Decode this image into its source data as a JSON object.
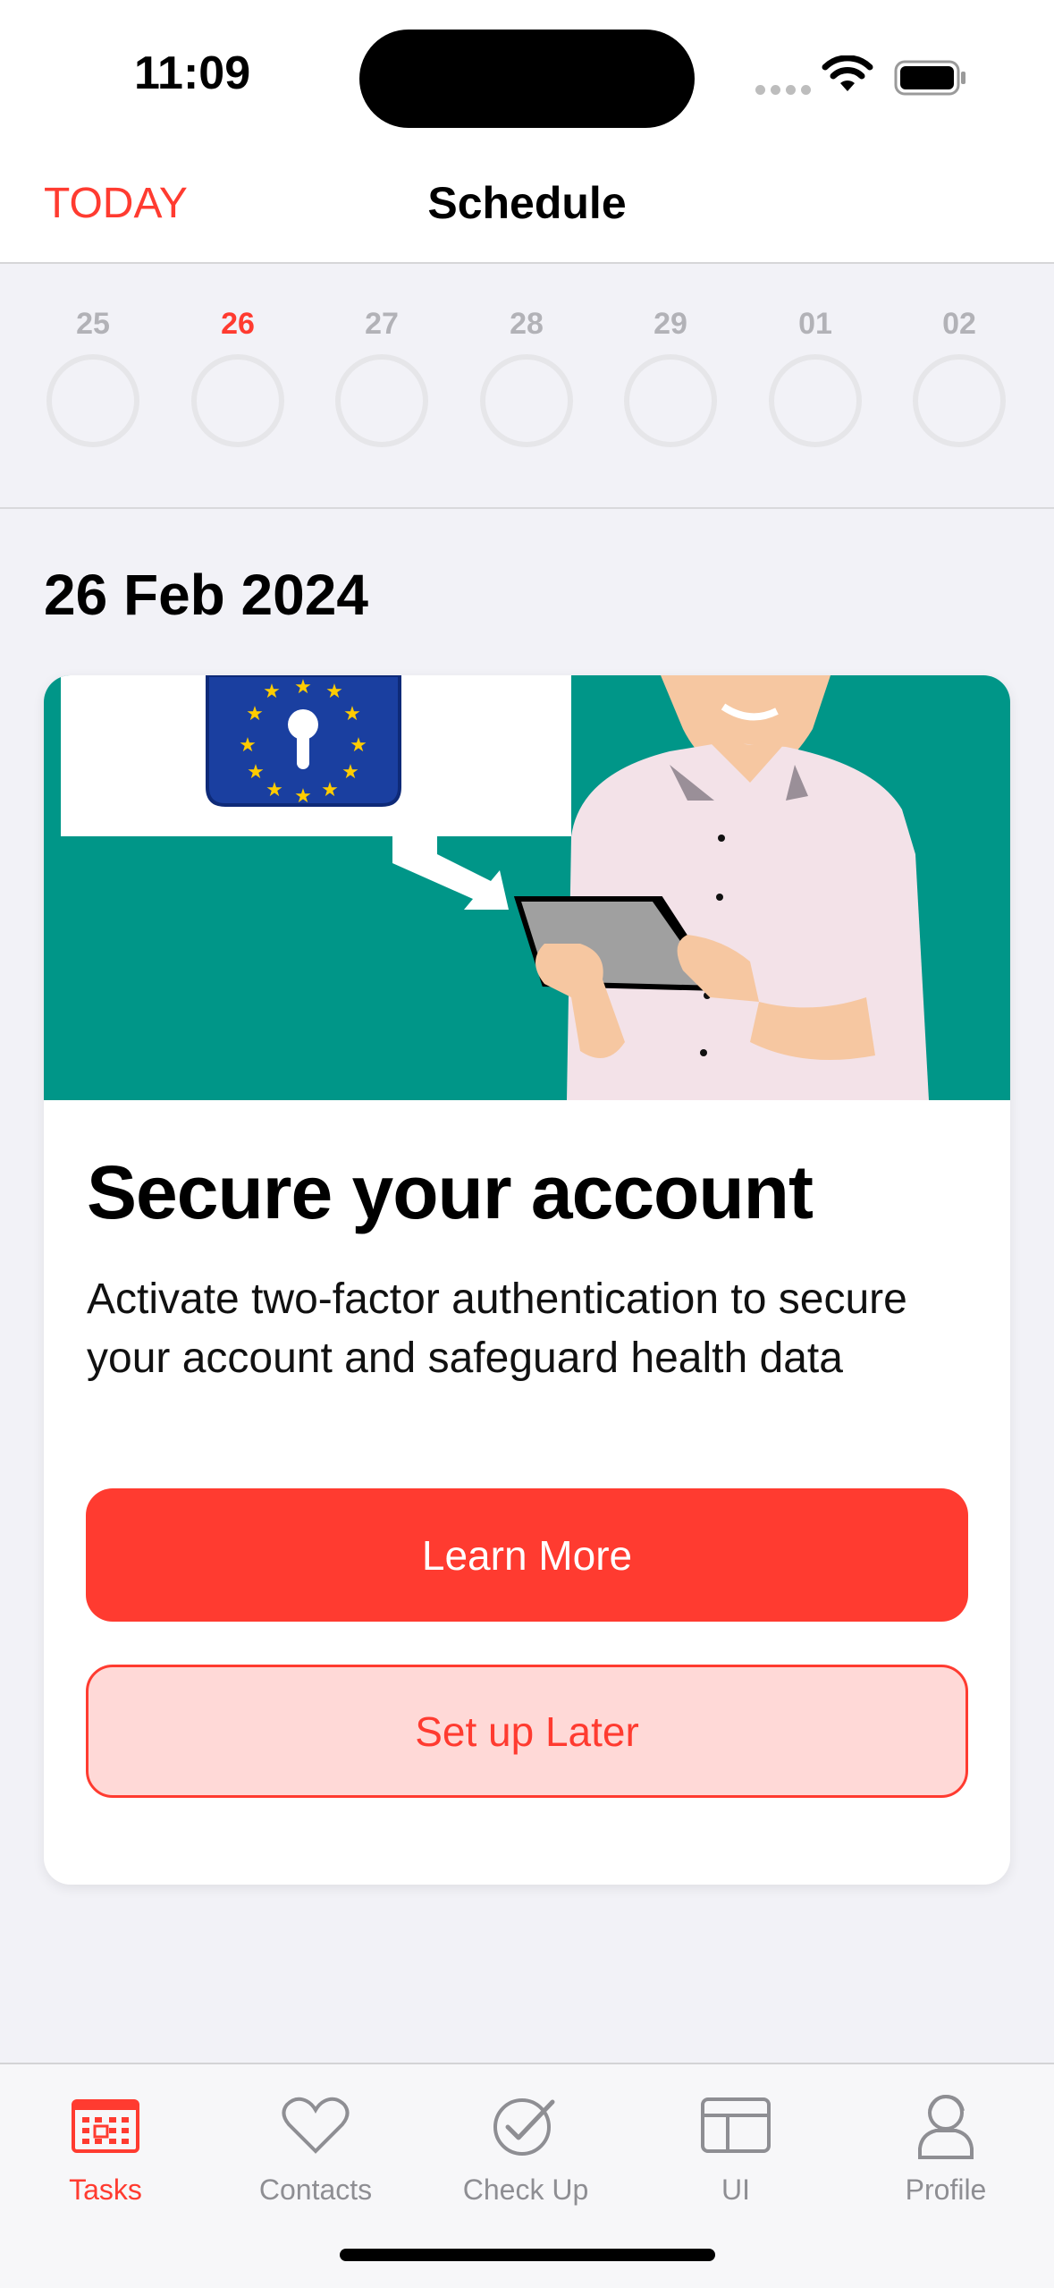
{
  "status": {
    "time": "11:09"
  },
  "nav": {
    "left_label": "TODAY",
    "title": "Schedule"
  },
  "days": [
    {
      "num": "25",
      "active": false
    },
    {
      "num": "26",
      "active": true
    },
    {
      "num": "27",
      "active": false
    },
    {
      "num": "28",
      "active": false
    },
    {
      "num": "29",
      "active": false
    },
    {
      "num": "01",
      "active": false
    },
    {
      "num": "02",
      "active": false
    }
  ],
  "date_heading": "26 Feb 2024",
  "card": {
    "title": "Secure your account",
    "text": "Activate two-factor authentication to secure your account and safeguard health data",
    "primary_button": "Learn More",
    "secondary_button": "Set up Later"
  },
  "tabs": [
    {
      "label": "Tasks",
      "icon": "calendar-icon",
      "active": true
    },
    {
      "label": "Contacts",
      "icon": "heart-icon",
      "active": false
    },
    {
      "label": "Check Up",
      "icon": "checkmark-seal-icon",
      "active": false
    },
    {
      "label": "UI",
      "icon": "layout-icon",
      "active": false
    },
    {
      "label": "Profile",
      "icon": "person-icon",
      "active": false
    }
  ],
  "colors": {
    "accent": "#FF3B30",
    "illustration_bg": "#009688",
    "eu_blue": "#1A3FA0"
  }
}
